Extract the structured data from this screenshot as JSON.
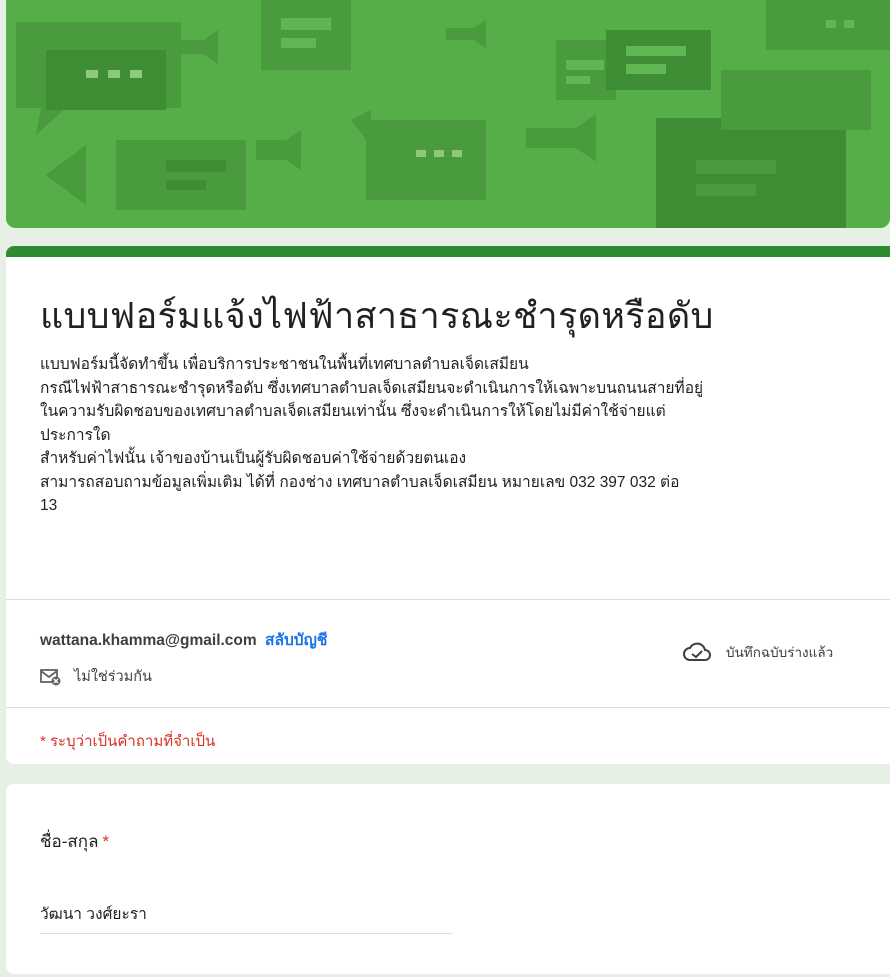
{
  "form": {
    "title": "แบบฟอร์มแจ้งไฟฟ้าสาธารณะชำรุดหรือดับ",
    "description": [
      "แบบฟอร์มนี้จัดทำขึ้น เพื่อบริการประชาชนในพื้นที่เทศบาลตำบลเจ็ดเสมียน",
      "กรณีไฟฟ้าสาธารณะชำรุดหรือดับ ซึ่งเทศบาลตำบลเจ็ดเสมียนจะดำเนินการให้เฉพาะบนถนนสายที่อยู่",
      "ในความรับผิดชอบของเทศบาลตำบลเจ็ดเสมียนเท่านั้น ซึ่งจะดำเนินการให้โดยไม่มีค่าใช้จ่ายแต่",
      "ประการใด",
      "สำหรับค่าไฟนั้น เจ้าของบ้านเป็นผู้รับผิดชอบค่าใช้จ่ายด้วยตนเอง",
      "สามารถสอบถามข้อมูลเพิ่มเติม ได้ที่ กองช่าง เทศบาลตำบลเจ็ดเสมียน หมายเลข 032 397 032 ต่อ",
      "13"
    ],
    "account_email": "wattana.khamma@gmail.com",
    "switch_account": "สลับบัญชี",
    "not_shared": "ไม่ใช่ร่วมกัน",
    "draft_saved": "บันทึกฉบับร่างแล้ว",
    "required_note": "* ระบุว่าเป็นคำถามที่จำเป็น"
  },
  "question": {
    "label": "ชื่อ-สกุล",
    "required_mark": "*",
    "answer": "วัฒนา วงศ์ยะรา"
  },
  "colors": {
    "banner": "#54ad46",
    "accent": "#2e8b31",
    "link": "#1a73e8",
    "required": "#d93025",
    "background": "#e6f0e4"
  },
  "icons": {
    "not_shared": "mail-off-icon",
    "draft_saved": "cloud-check-icon"
  }
}
